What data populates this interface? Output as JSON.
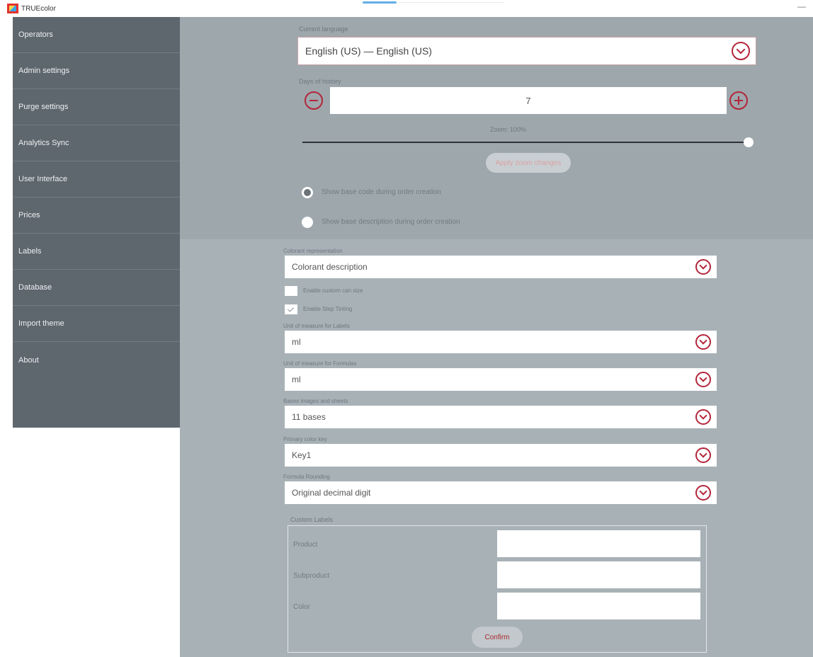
{
  "app": {
    "title": "TRUEcolor",
    "minimize_glyph": "—"
  },
  "sidebar": {
    "items": [
      {
        "label": "Operators"
      },
      {
        "label": "Admin settings"
      },
      {
        "label": "Purge settings"
      },
      {
        "label": "Analytics Sync"
      },
      {
        "label": "User Interface"
      },
      {
        "label": "Prices"
      },
      {
        "label": "Labels"
      },
      {
        "label": "Database"
      },
      {
        "label": "Import theme"
      },
      {
        "label": "About"
      }
    ]
  },
  "settings": {
    "language": {
      "label": "Current language",
      "value": "English (US) — English (US)"
    },
    "history": {
      "label": "Days of history",
      "value": "7"
    },
    "zoom": {
      "label": "Zoom: 100%",
      "level_percent": 100,
      "apply_label": "Apply zoom changes"
    },
    "base_options": [
      {
        "label": "Show base code during order creation",
        "selected": true
      },
      {
        "label": "Show base description during order creation",
        "selected": false
      }
    ],
    "colorant_representation": {
      "label": "Colorant representation",
      "value": "Colorant description"
    },
    "checkboxes": [
      {
        "label": "Enable custom can size",
        "checked": false
      },
      {
        "label": "Enable Step Tinting",
        "checked": true
      }
    ],
    "unit_labels": {
      "label": "Unit of measure for Labels",
      "value": "ml"
    },
    "unit_formulas": {
      "label": "Unit of measure for Formulas",
      "value": "ml"
    },
    "bases_images": {
      "label": "Bases images and sheets",
      "value": "11 bases"
    },
    "primary_color_key": {
      "label": "Primary color key",
      "value": "Key1"
    },
    "formula_rounding": {
      "label": "Formula Rounding",
      "value": "Original decimal digit"
    },
    "custom_labels": {
      "title": "Custom Labels",
      "rows": [
        {
          "label": "Product",
          "value": ""
        },
        {
          "label": "Subproduct",
          "value": ""
        },
        {
          "label": "Color",
          "value": ""
        }
      ],
      "confirm_label": "Confirm"
    }
  },
  "colors": {
    "accent": "#b3253a",
    "sidebar_bg": "#5e666e",
    "panel_bg": "#a8b1b6",
    "upper_panel_bg": "#9ea7ac"
  }
}
